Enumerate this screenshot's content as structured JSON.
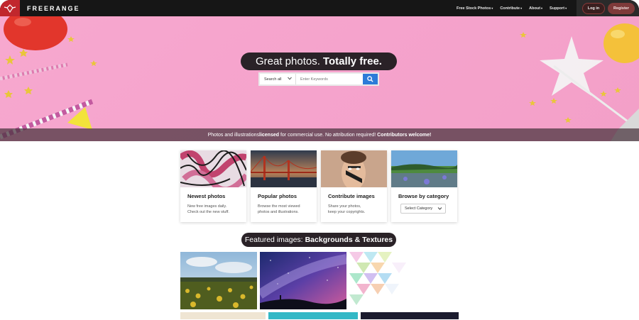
{
  "brand": {
    "name": "FREERANGE",
    "accent": "#c1272d"
  },
  "nav": {
    "items": [
      {
        "label": "Free Stock Photos",
        "caret": "▾"
      },
      {
        "label": "Contribute",
        "caret": "▾"
      },
      {
        "label": "About",
        "caret": "▾"
      },
      {
        "label": "Support",
        "caret": "▾"
      }
    ],
    "login_label": "Log in",
    "register_label": "Register"
  },
  "hero": {
    "title_regular": "Great photos.",
    "title_bold": "Totally free.",
    "search": {
      "scope_value": "Search all",
      "placeholder": "Enter Keywords",
      "button_icon": "search-icon"
    },
    "tagline_parts": [
      {
        "text": "Photos and illustrations ",
        "bold": false
      },
      {
        "text": "licensed",
        "bold": true
      },
      {
        "text": " for commercial use. No attribution required! ",
        "bold": false
      },
      {
        "text": "Contributors welcome!",
        "bold": true
      }
    ]
  },
  "cards": [
    {
      "title": "Newest photos",
      "desc_line1": "New free images daily.",
      "desc_line2": "Check out the new stuff."
    },
    {
      "title": "Popular photos",
      "desc_line1": "Browse the most viewed",
      "desc_line2": "photos and illustrations."
    },
    {
      "title": "Contribute images",
      "desc_line1": "Share your photos,",
      "desc_line2": "keep your copyrights."
    },
    {
      "title": "Browse by category",
      "select_value": "Select Category"
    }
  ],
  "featured": {
    "label_regular": "Featured images:",
    "label_bold": "Backgrounds & Textures"
  }
}
